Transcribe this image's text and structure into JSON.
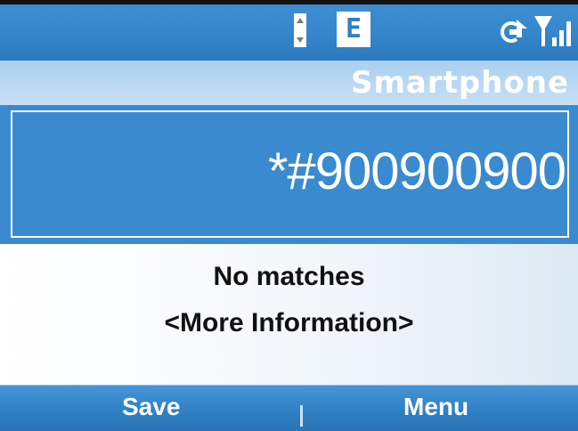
{
  "status_bar": {
    "network_indicator": "E",
    "icons": [
      "scroll-indicator-icon",
      "edge-network-icon",
      "gprs-connection-icon",
      "signal-strength-icon"
    ]
  },
  "title_bar": {
    "title": "Smartphone"
  },
  "dialer": {
    "number": "*#900900900"
  },
  "results": {
    "no_matches": "No matches",
    "more_info": "<More Information>"
  },
  "softkeys": {
    "left": "Save",
    "right": "Menu"
  },
  "colors": {
    "status_blue": "#3586cc",
    "title_light_blue": "#b8d8f2",
    "field_blue": "#3a8ad0",
    "softkey_blue": "#2f7fc4"
  }
}
